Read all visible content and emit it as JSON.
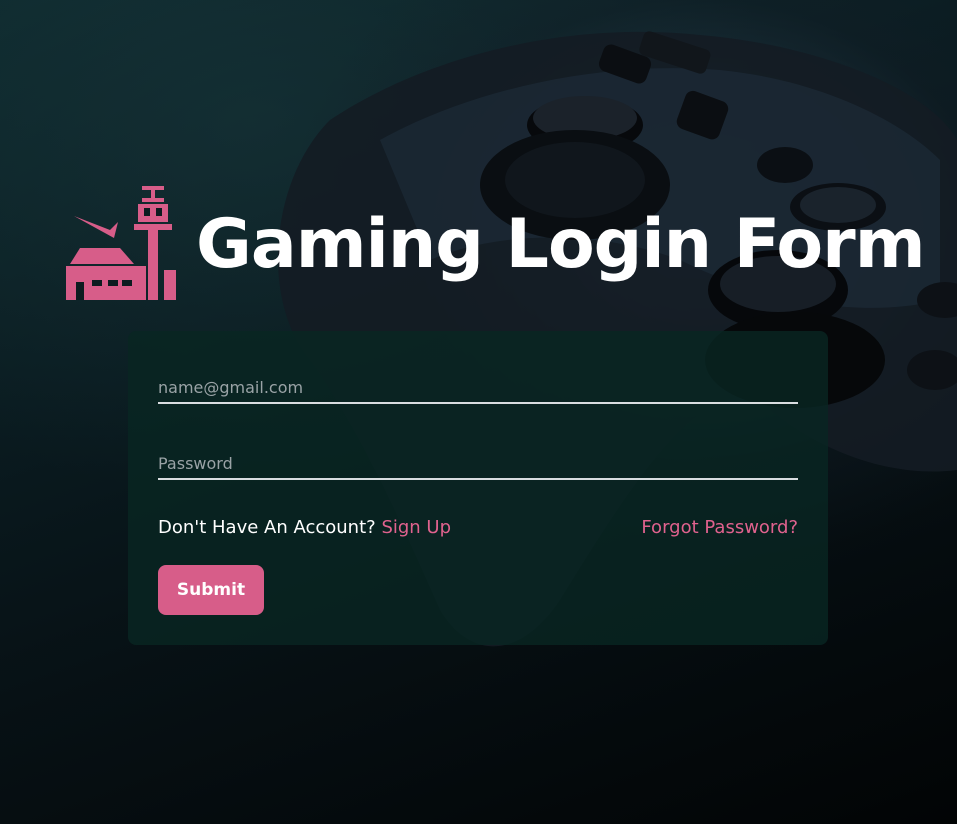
{
  "header": {
    "title": "Gaming Login Form",
    "logo_icon": "airport-control-tower-icon"
  },
  "form": {
    "email_placeholder": "name@gmail.com",
    "email_value": "",
    "password_placeholder": "Password",
    "password_value": "",
    "no_account_text": "Don't Have An Account?",
    "signup_link": "Sign Up",
    "forgot_link": "Forgot Password?",
    "submit_label": "Submit"
  },
  "colors": {
    "accent": "#d75d89",
    "card_background": "#082622",
    "text": "#ffffff"
  }
}
